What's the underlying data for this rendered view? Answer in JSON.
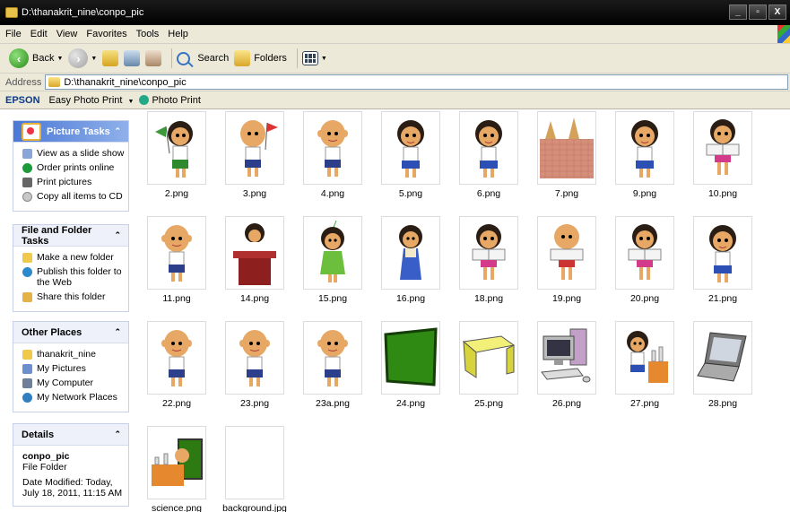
{
  "window": {
    "title": "D:\\thanakrit_nine\\conpo_pic",
    "min": "_",
    "max": "▫",
    "close": "X"
  },
  "menu": [
    "File",
    "Edit",
    "View",
    "Favorites",
    "Tools",
    "Help"
  ],
  "toolbar": {
    "back": "Back",
    "search": "Search",
    "folders": "Folders"
  },
  "address": {
    "label": "Address",
    "value": "D:\\thanakrit_nine\\conpo_pic"
  },
  "epson": {
    "brand": "EPSON",
    "easy": "Easy Photo Print",
    "photo": "Photo Print"
  },
  "picture_tasks": {
    "title": "Picture Tasks",
    "items": [
      "View as a slide show",
      "Order prints online",
      "Print pictures",
      "Copy all items to CD"
    ]
  },
  "file_tasks": {
    "title": "File and Folder Tasks",
    "items": [
      "Make a new folder",
      "Publish this folder to the Web",
      "Share this folder"
    ]
  },
  "other_places": {
    "title": "Other Places",
    "items": [
      "thanakrit_nine",
      "My Pictures",
      "My Computer",
      "My Network Places"
    ]
  },
  "details": {
    "title": "Details",
    "name": "conpo_pic",
    "type": "File Folder",
    "modified": "Date Modified: Today, July 18, 2011, 11:15 AM"
  },
  "files": [
    {
      "name": "2.png",
      "kind": "girl-flag"
    },
    {
      "name": "3.png",
      "kind": "boy-flag"
    },
    {
      "name": "4.png",
      "kind": "boy"
    },
    {
      "name": "5.png",
      "kind": "girl"
    },
    {
      "name": "6.png",
      "kind": "girl"
    },
    {
      "name": "7.png",
      "kind": "temple"
    },
    {
      "name": "9.png",
      "kind": "girl"
    },
    {
      "name": "10.png",
      "kind": "girl-book"
    },
    {
      "name": "11.png",
      "kind": "boy"
    },
    {
      "name": "14.png",
      "kind": "podium"
    },
    {
      "name": "15.png",
      "kind": "girl-green"
    },
    {
      "name": "16.png",
      "kind": "girl-blue"
    },
    {
      "name": "18.png",
      "kind": "girl-book"
    },
    {
      "name": "19.png",
      "kind": "boy-book"
    },
    {
      "name": "20.png",
      "kind": "girl-book"
    },
    {
      "name": "21.png",
      "kind": "girl"
    },
    {
      "name": "22.png",
      "kind": "boy"
    },
    {
      "name": "23.png",
      "kind": "boy"
    },
    {
      "name": "23a.png",
      "kind": "boy"
    },
    {
      "name": "24.png",
      "kind": "board"
    },
    {
      "name": "25.png",
      "kind": "table"
    },
    {
      "name": "26.png",
      "kind": "computer"
    },
    {
      "name": "27.png",
      "kind": "girl-lab"
    },
    {
      "name": "28.png",
      "kind": "laptop"
    },
    {
      "name": "science.png",
      "kind": "science"
    },
    {
      "name": "background.jpg",
      "kind": "blank"
    }
  ]
}
